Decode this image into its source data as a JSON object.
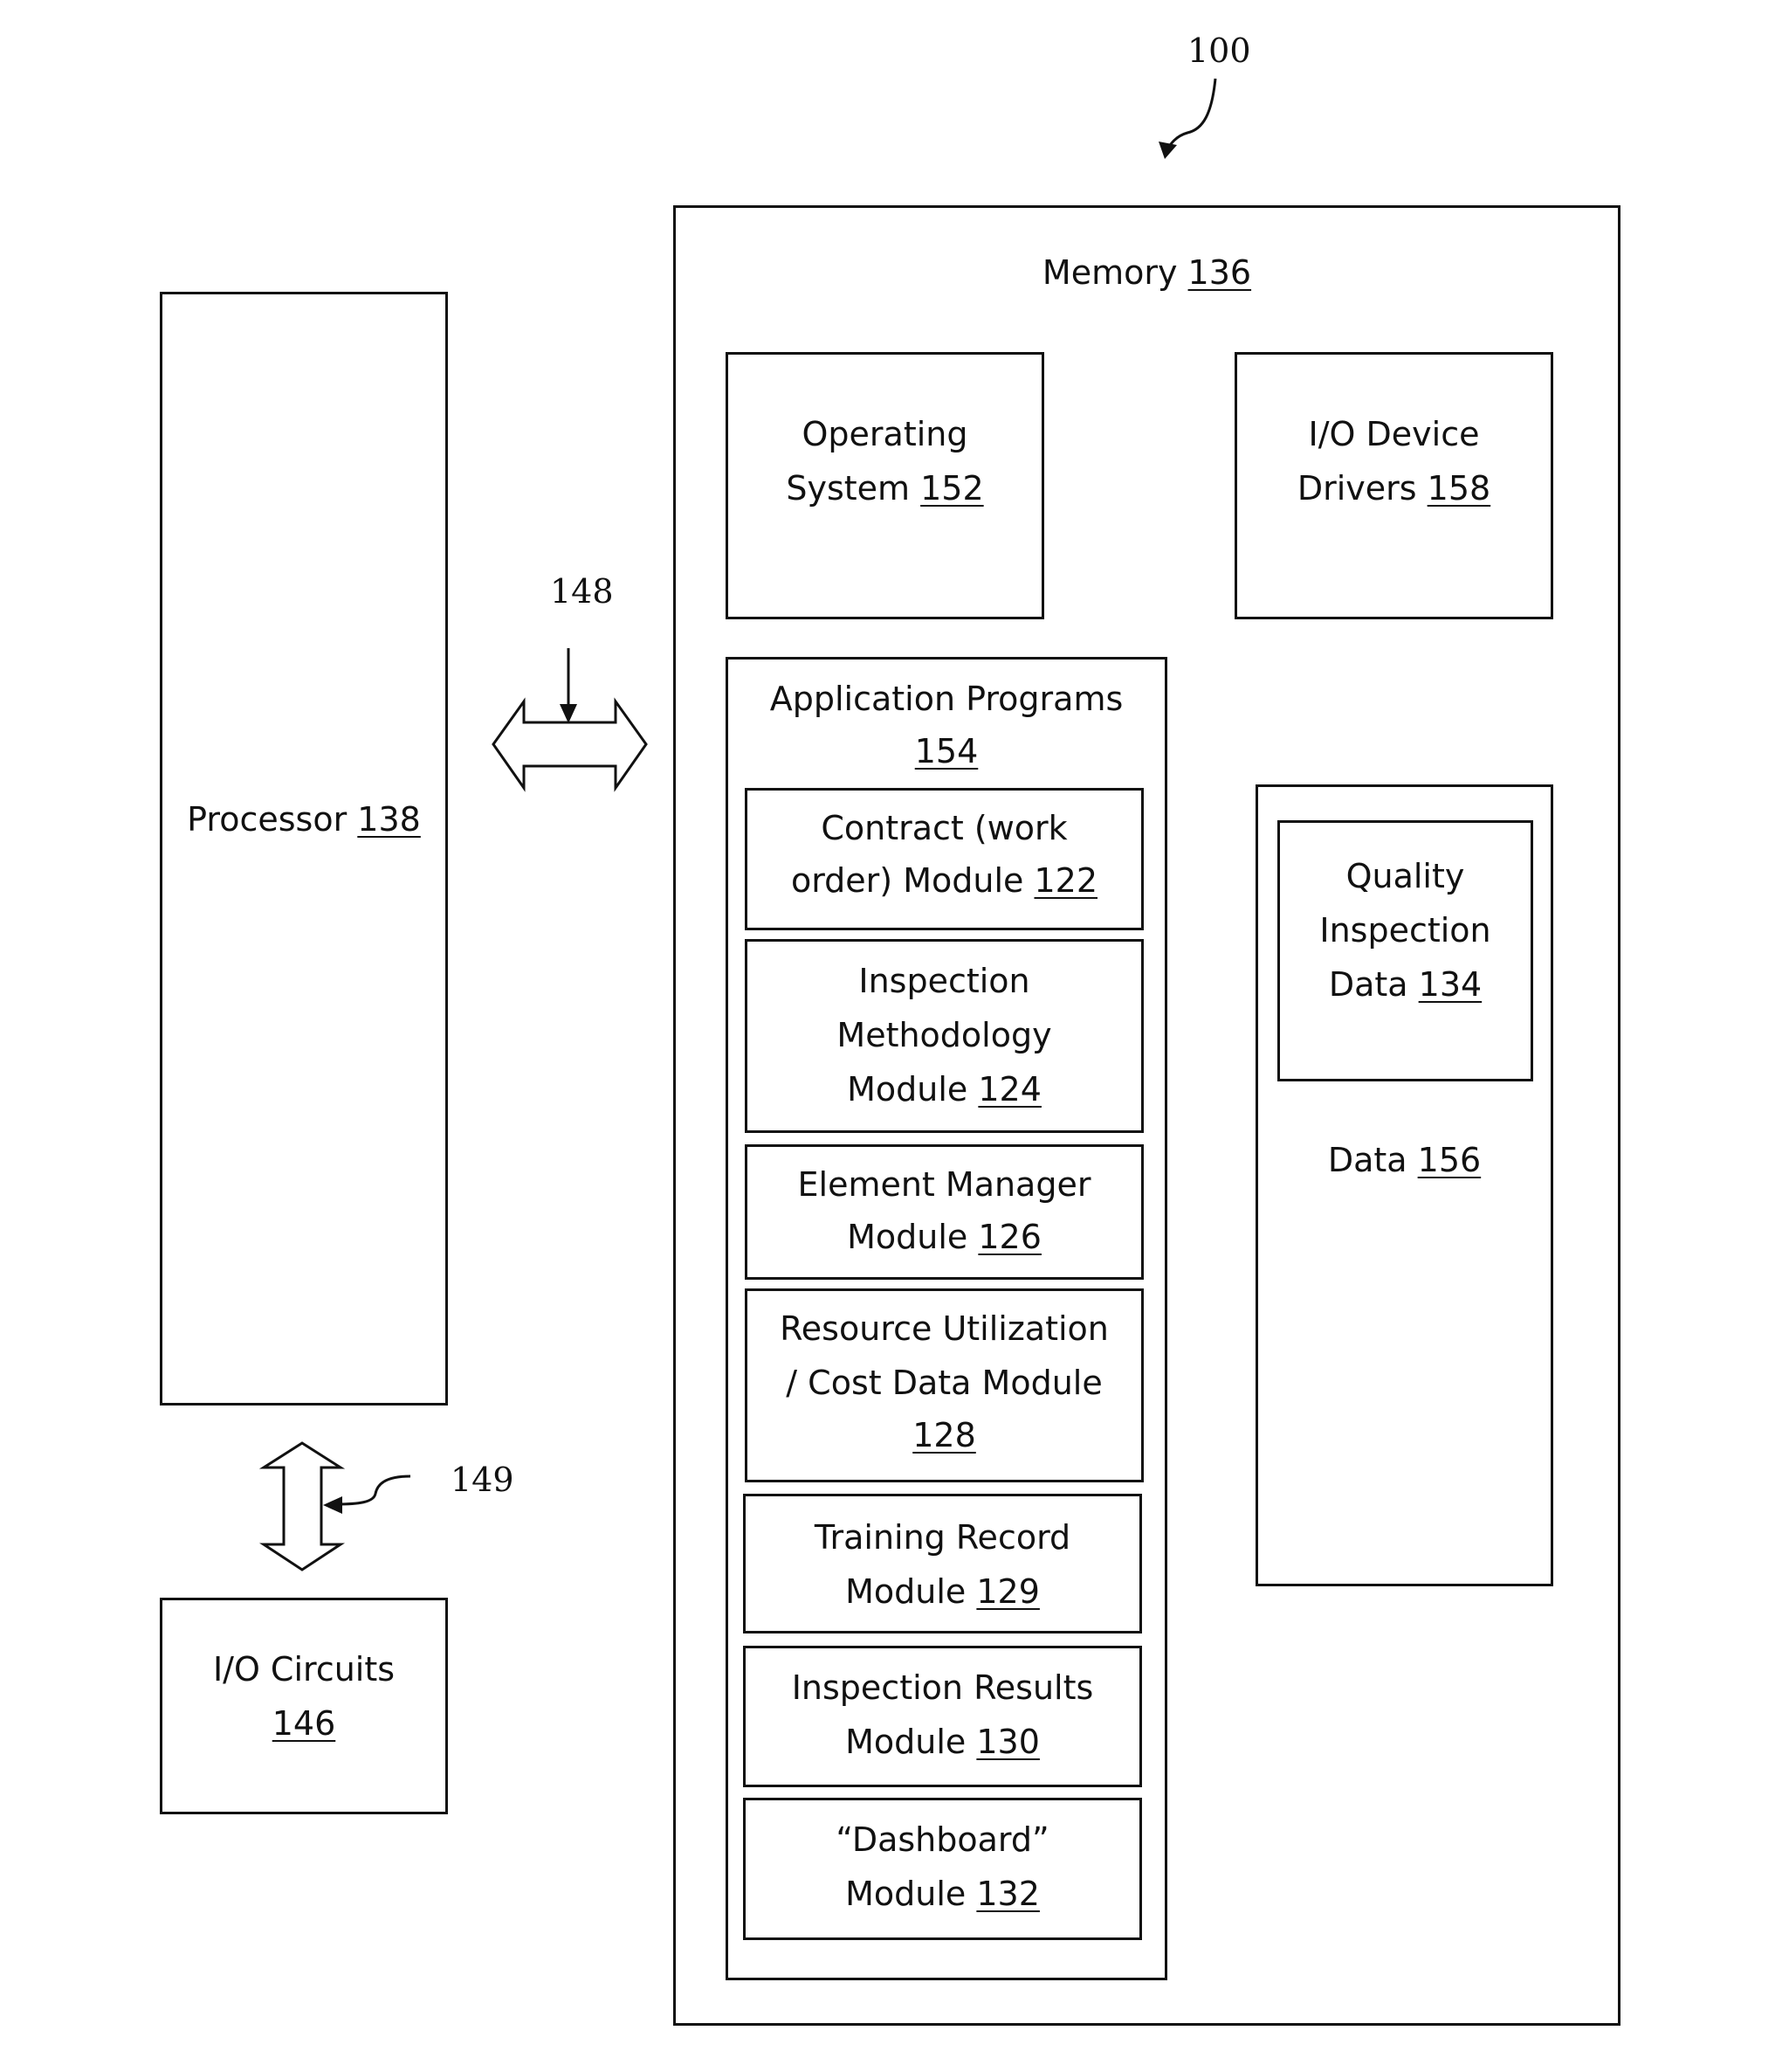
{
  "figure_ref": "100",
  "processor": {
    "label": "Processor",
    "ref": "138"
  },
  "io_circuits": {
    "label": "I/O Circuits",
    "ref": "146"
  },
  "bus_ref_memory": "148",
  "bus_ref_io": "149",
  "memory": {
    "label": "Memory",
    "ref": "136",
    "operating_system": {
      "line1": "Operating",
      "line2": "System",
      "ref": "152"
    },
    "io_device_drivers": {
      "line1": "I/O Device",
      "line2": "Drivers",
      "ref": "158"
    },
    "application_programs": {
      "label": "Application Programs",
      "ref": "154",
      "modules": [
        {
          "lines": [
            "Contract (work",
            "order) Module"
          ],
          "ref": "122"
        },
        {
          "lines": [
            "Inspection",
            "Methodology",
            "Module"
          ],
          "ref": "124"
        },
        {
          "lines": [
            "Element Manager",
            "Module"
          ],
          "ref": "126"
        },
        {
          "lines": [
            "Resource Utilization",
            "/ Cost Data  Module"
          ],
          "ref": "128"
        },
        {
          "lines": [
            "Training Record",
            "Module"
          ],
          "ref": "129"
        },
        {
          "lines": [
            "Inspection Results",
            "Module"
          ],
          "ref": "130"
        },
        {
          "lines": [
            "“Dashboard”",
            "Module"
          ],
          "ref": "132"
        }
      ]
    },
    "data": {
      "label": "Data",
      "ref": "156",
      "quality_inspection": {
        "lines": [
          "Quality",
          "Inspection",
          "Data"
        ],
        "ref": "134"
      }
    }
  }
}
